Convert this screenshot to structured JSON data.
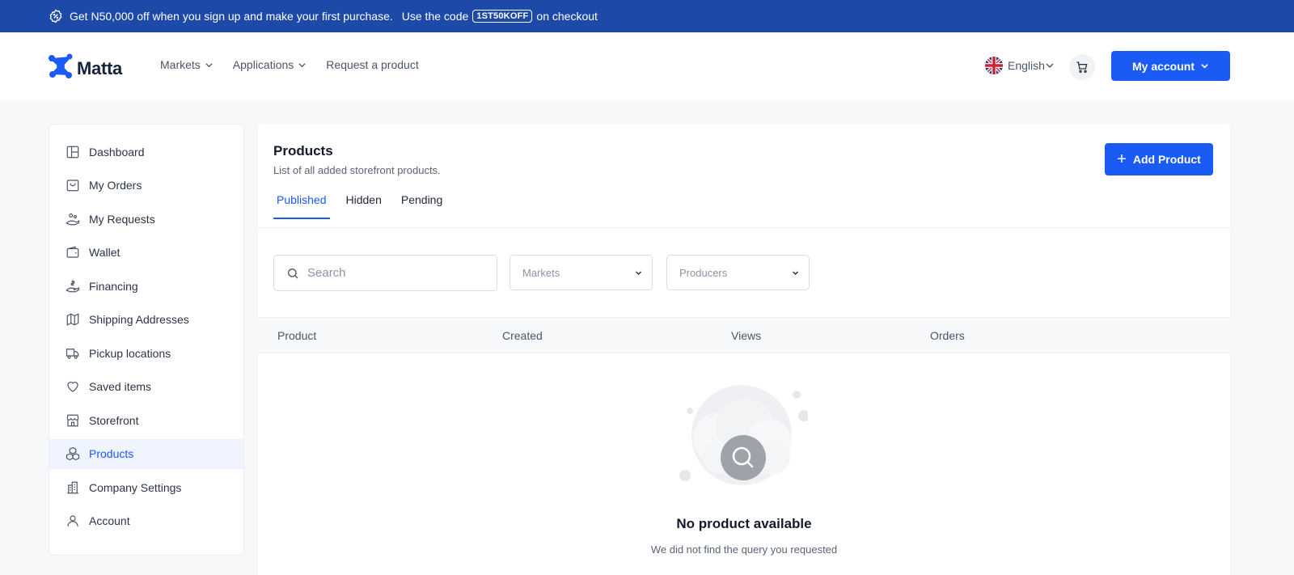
{
  "promo": {
    "text_before": "Get N50,000 off when you sign up and make your first purchase.",
    "text_use": "Use the code",
    "code": "1ST50KOFF",
    "text_after": "on checkout"
  },
  "header": {
    "logo": "Matta",
    "nav": [
      "Markets",
      "Applications",
      "Request a product"
    ],
    "language": "English",
    "account_label": "My account"
  },
  "sidebar": {
    "items": [
      {
        "label": "Dashboard",
        "icon": "dashboard-icon"
      },
      {
        "label": "My Orders",
        "icon": "bag-icon"
      },
      {
        "label": "My Requests",
        "icon": "request-icon"
      },
      {
        "label": "Wallet",
        "icon": "wallet-icon"
      },
      {
        "label": "Financing",
        "icon": "financing-icon"
      },
      {
        "label": "Shipping Addresses",
        "icon": "map-icon"
      },
      {
        "label": "Pickup locations",
        "icon": "truck-icon"
      },
      {
        "label": "Saved items",
        "icon": "heart-icon"
      },
      {
        "label": "Storefront",
        "icon": "storefront-icon"
      },
      {
        "label": "Products",
        "icon": "boxes-icon",
        "active": true
      },
      {
        "label": "Company Settings",
        "icon": "building-icon"
      },
      {
        "label": "Account",
        "icon": "user-icon"
      }
    ]
  },
  "main": {
    "title": "Products",
    "subtitle": "List of all added storefront products.",
    "add_button": "Add Product",
    "tabs": [
      {
        "label": "Published",
        "active": true
      },
      {
        "label": "Hidden"
      },
      {
        "label": "Pending"
      }
    ],
    "search_placeholder": "Search",
    "filters": [
      "Markets",
      "Producers"
    ],
    "table_headers": [
      "Product",
      "Created",
      "Views",
      "Orders"
    ],
    "empty_title": "No product available",
    "empty_subtitle": "We did not find the query you requested"
  },
  "colors": {
    "brand": "#1a5af5",
    "promo_bg": "#1d4aa8"
  }
}
